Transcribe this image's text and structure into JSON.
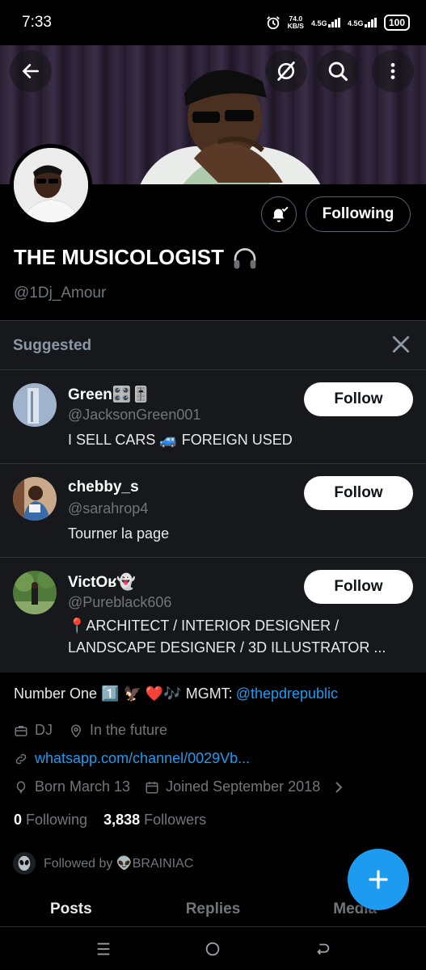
{
  "status_bar": {
    "time": "7:33",
    "net_speed_value": "74.0",
    "net_speed_unit": "KB/S",
    "sim1": "4.5G",
    "sim2": "4.5G",
    "battery": "100"
  },
  "profile": {
    "display_name": "THE MUSICOLOGIST",
    "handle": "@1Dj_Amour",
    "following_button": "Following",
    "bio_text": "Number One 1️⃣ 🦅 ❤️🎶 MGMT:",
    "bio_link": "@thepdrepublic",
    "category": "DJ",
    "location": "In the future",
    "website": "whatsapp.com/channel/0029Vb...",
    "birthday": "Born March 13",
    "joined": "Joined September 2018",
    "following_count": "0",
    "following_label": "Following",
    "followers_count": "3,838",
    "followers_label": "Followers",
    "followed_by": "Followed by 👽BRAINIAC"
  },
  "suggested": {
    "title": "Suggested",
    "follow_label": "Follow",
    "items": [
      {
        "name": "Green🎛️🎚️",
        "handle": "@JacksonGreen001",
        "bio": "I SELL CARS 🚙 FOREIGN USED"
      },
      {
        "name": "chebby_s",
        "handle": "@sarahrop4",
        "bio": "Tourner la page"
      },
      {
        "name": "VictOʁ👻",
        "handle": "@Pureblack606",
        "bio": "📍ARCHITECT / INTERIOR DESIGNER / LANDSCAPE DESIGNER / 3D ILLUSTRATOR ..."
      }
    ]
  },
  "tabs": [
    "Posts",
    "Replies",
    "Media"
  ],
  "colors": {
    "accent": "#1d9bf0",
    "background": "#000000",
    "muted": "#71767b"
  }
}
